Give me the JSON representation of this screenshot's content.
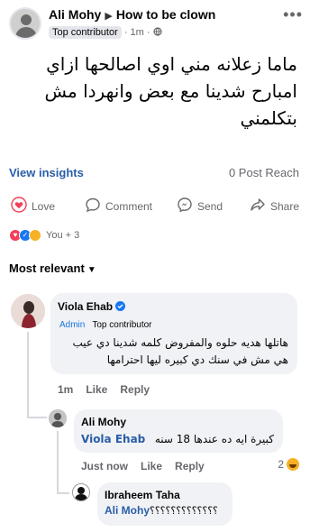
{
  "post": {
    "author": "Ali Mohy",
    "group": "How to be clown",
    "author_badge": "Top contributor",
    "time": "1m",
    "text": "ماما زعلانه مني اوي اصالحها ازاي امبارح شدينا مع بعض وانهردا مش بتكلمني"
  },
  "insights": {
    "view_label": "View insights",
    "reach": "0 Post Reach"
  },
  "actions": {
    "love": "Love",
    "comment": "Comment",
    "send": "Send",
    "share": "Share"
  },
  "reactions": {
    "summary": "You + 3"
  },
  "sort": {
    "label": "Most relevant"
  },
  "comments": [
    {
      "name": "Viola Ehab",
      "badge_admin": "Admin",
      "badge_top": "Top contributor",
      "text": "هاتلها هديه حلوه والمفروض كلمه شدينا دي عيب هي مش في سنك دي كبيره ليها احترامها",
      "time": "1m",
      "like": "Like",
      "reply": "Reply"
    }
  ],
  "replies": [
    {
      "name": "Ali Mohy",
      "mention": "Viola Ehab",
      "text": "كبيرة ايه ده عندها 18 سنه",
      "time": "Just now",
      "like": "Like",
      "reply": "Reply",
      "reaction_count": "2"
    },
    {
      "name": "Ibraheem Taha",
      "mention": "Ali Mohy",
      "text": "؟؟؟؟؟؟؟؟؟؟؟؟؟"
    }
  ],
  "colors": {
    "link": "#285ea8",
    "love_icon": "#f33e58",
    "bubble": "#f0f2f5"
  }
}
